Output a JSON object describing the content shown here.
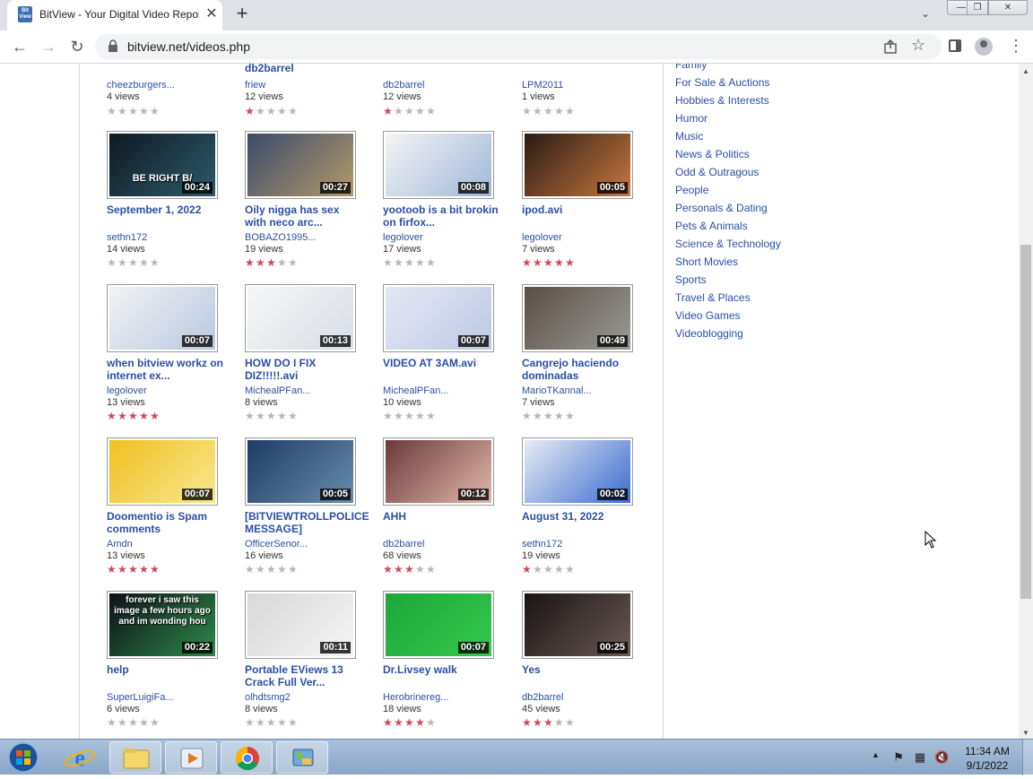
{
  "browser": {
    "tab_title": "BitView - Your Digital Video Repository",
    "tab_close": "✕",
    "new_tab": "+",
    "favicon_text": "Bit View",
    "url": "bitview.net/videos.php",
    "window_controls": {
      "minimize": "—",
      "maximize": "❐",
      "close": "✕"
    }
  },
  "partial_row": [
    {
      "title": "",
      "user": "cheezburgers...",
      "views": "4 views",
      "rating": 0
    },
    {
      "title": "db2barrel",
      "user": "friew",
      "views": "12 views",
      "rating": 1
    },
    {
      "title": "",
      "user": "db2barrel",
      "views": "12 views",
      "rating": 1
    },
    {
      "title": "",
      "user": "LPM2011",
      "views": "1 views",
      "rating": 0
    }
  ],
  "videos": [
    {
      "title": "September 1, 2022",
      "user": "sethn172",
      "views": "14 views",
      "duration": "00:24",
      "rating": 0,
      "thumb_text": "BE RIGHT B/",
      "colors": [
        "#0e1a22",
        "#2c5a6a"
      ]
    },
    {
      "title": "Oily nigga has sex with neco arc...",
      "user": "BOBAZO1995...",
      "views": "19 views",
      "duration": "00:27",
      "rating": 3,
      "thumb_text": "",
      "colors": [
        "#3b4b6a",
        "#b49a6a"
      ]
    },
    {
      "title": "yootoob is a bit brokin on firfox...",
      "user": "legolover",
      "views": "17 views",
      "duration": "00:08",
      "rating": 0,
      "thumb_text": "",
      "colors": [
        "#f4f4f4",
        "#9fb8d8"
      ]
    },
    {
      "title": "ipod.avi",
      "user": "legolover",
      "views": "7 views",
      "duration": "00:05",
      "rating": 5,
      "thumb_text": "",
      "colors": [
        "#2a1a12",
        "#c87840"
      ]
    },
    {
      "title": "when bitview workz on internet ex...",
      "user": "legolover",
      "views": "13 views",
      "duration": "00:07",
      "rating": 5,
      "thumb_text": "",
      "colors": [
        "#f2f2f2",
        "#b8c8e0"
      ]
    },
    {
      "title": "HOW DO I FIX DIZ!!!!!.avi",
      "user": "MichealPFan...",
      "views": "8 views",
      "duration": "00:13",
      "rating": 0,
      "thumb_text": "",
      "colors": [
        "#f6f6f6",
        "#d8dde6"
      ]
    },
    {
      "title": "VIDEO AT 3AM.avi",
      "user": "MichealPFan...",
      "views": "10 views",
      "duration": "00:07",
      "rating": 0,
      "thumb_text": "",
      "colors": [
        "#e4e8f4",
        "#bcc8e4"
      ]
    },
    {
      "title": "Cangrejo haciendo dominadas",
      "user": "MarioTKannal...",
      "views": "7 views",
      "duration": "00:49",
      "rating": 0,
      "thumb_text": "",
      "colors": [
        "#5a4e44",
        "#9a9a96"
      ]
    },
    {
      "title": "Doomentio is Spam comments",
      "user": "Amdn",
      "views": "13 views",
      "duration": "00:07",
      "rating": 5,
      "thumb_text": "",
      "colors": [
        "#f0c020",
        "#f8e890"
      ]
    },
    {
      "title": "[BITVIEWTROLLPOLICE MESSAGE]",
      "user": "OfficerSenor...",
      "views": "16 views",
      "duration": "00:05",
      "rating": 0,
      "thumb_text": "",
      "colors": [
        "#1e3c64",
        "#6a8cb0"
      ]
    },
    {
      "title": "AHH",
      "user": "db2barrel",
      "views": "68 views",
      "duration": "00:12",
      "rating": 3,
      "thumb_text": "",
      "colors": [
        "#6a3a3a",
        "#e2b8aa"
      ]
    },
    {
      "title": "August 31, 2022",
      "user": "sethn172",
      "views": "19 views",
      "duration": "00:02",
      "rating": 1,
      "thumb_text": "",
      "colors": [
        "#e8ecf4",
        "#3a6cd0"
      ]
    },
    {
      "title": "help",
      "user": "SuperLuigiFa...",
      "views": "6 views",
      "duration": "00:22",
      "rating": 0,
      "thumb_text": "forever i saw this image a few hours ago and im wonding hou",
      "colors": [
        "#10101a",
        "#2c8a4a"
      ]
    },
    {
      "title": "Portable EViews 13 Crack Full Ver...",
      "user": "olhdtsmg2",
      "views": "8 views",
      "duration": "00:11",
      "rating": 0,
      "thumb_text": "",
      "colors": [
        "#d8d8d8",
        "#f4f4f4"
      ]
    },
    {
      "title": "Dr.Livsey walk",
      "user": "Herobrinereg...",
      "views": "18 views",
      "duration": "00:07",
      "rating": 4,
      "thumb_text": "",
      "colors": [
        "#1ea83a",
        "#34c84c"
      ]
    },
    {
      "title": "Yes",
      "user": "db2barrel",
      "views": "45 views",
      "duration": "00:25",
      "rating": 3,
      "thumb_text": "",
      "colors": [
        "#1a1414",
        "#6a5a54"
      ]
    }
  ],
  "categories": [
    "Family",
    "For Sale & Auctions",
    "Hobbies & Interests",
    "Humor",
    "Music",
    "News & Politics",
    "Odd & Outragous",
    "People",
    "Personals & Dating",
    "Pets & Animals",
    "Science & Technology",
    "Short Movies",
    "Sports",
    "Travel & Places",
    "Video Games",
    "Videoblogging"
  ],
  "taskbar": {
    "time": "11:34 AM",
    "date": "9/1/2022",
    "apps": [
      "internet-explorer",
      "file-explorer",
      "media-player",
      "chrome",
      "control-panel"
    ]
  },
  "colors": {
    "link": "#2a4fa8",
    "star_on": "#d0485a",
    "star_off": "#b7b7b7"
  }
}
